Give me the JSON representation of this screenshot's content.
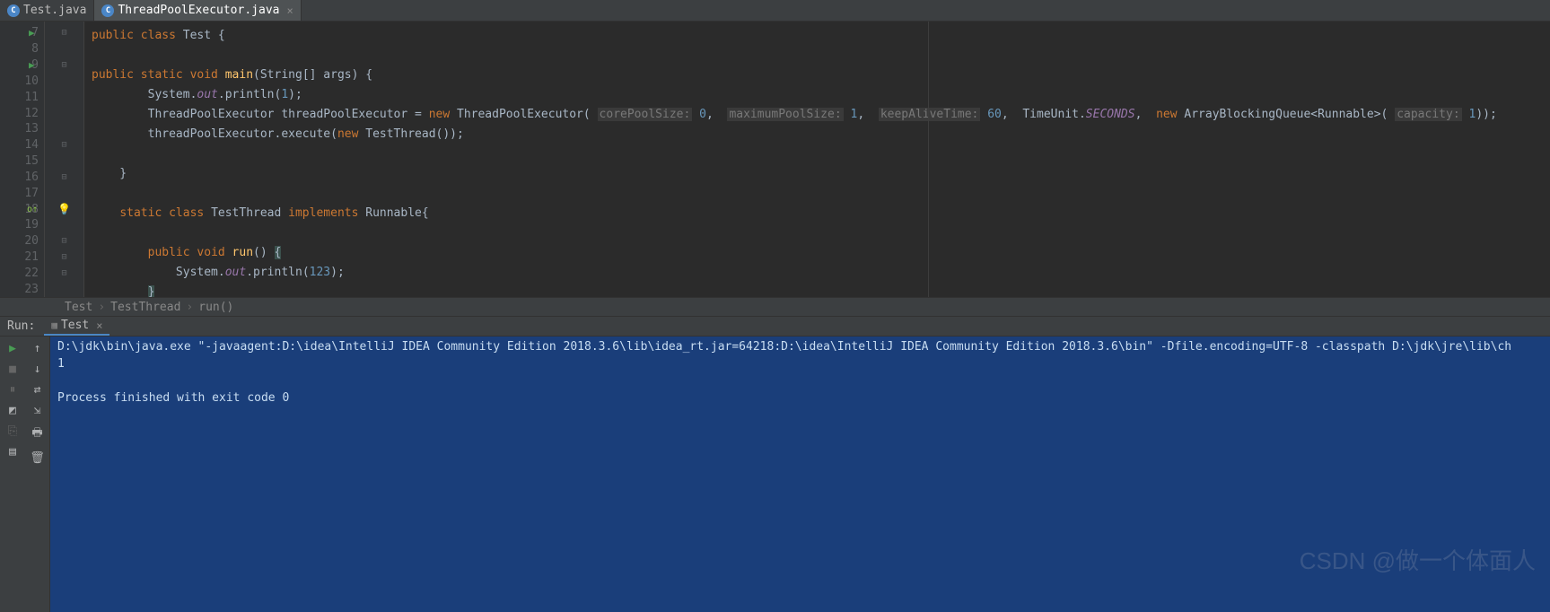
{
  "tabs": [
    {
      "label": "Test.java",
      "active": false
    },
    {
      "label": "ThreadPoolExecutor.java",
      "active": true
    }
  ],
  "line_numbers": [
    "7",
    "8",
    "9",
    "10",
    "11",
    "12",
    "13",
    "14",
    "15",
    "16",
    "17",
    "18",
    "19",
    "20",
    "21",
    "22",
    "23"
  ],
  "code": {
    "l7": {
      "pre": "public class ",
      "cls": "Test",
      "post": " {"
    },
    "l9": {
      "pre": "    ",
      "kw1": "public static void ",
      "fn": "main",
      "post": "(String[] args) {"
    },
    "l10": {
      "pre": "        System.",
      "field": "out",
      "mid": ".println(",
      "num": "1",
      "post": ");"
    },
    "l11": {
      "pre": "        ThreadPoolExecutor threadPoolExecutor = ",
      "kw": "new",
      "mid1": " ThreadPoolExecutor( ",
      "hint1": "corePoolSize:",
      "n1": " 0",
      "c1": ",  ",
      "hint2": "maximumPoolSize:",
      "n2": " 1",
      "c2": ",  ",
      "hint3": "keepAliveTime:",
      "n3": " 60",
      "c3": ",  TimeUnit.",
      "field2": "SECONDS",
      "c4": ",  ",
      "kw2": "new",
      "mid2": " ArrayBlockingQueue<Runnable>( ",
      "hint4": "capacity:",
      "n4": " 1",
      "post": "));"
    },
    "l12": {
      "pre": "        threadPoolExecutor.execute(",
      "kw": "new",
      "mid": " TestThread())",
      "post": ";"
    },
    "l14": {
      "txt": "    }"
    },
    "l16": {
      "pre": "    ",
      "kw1": "static class ",
      "cls": "TestThread ",
      "kw2": "implements ",
      "iface": "Runnable",
      "post": "{"
    },
    "l18": {
      "pre": "        ",
      "kw": "public void ",
      "fn": "run",
      "post": "() ",
      "brace": "{"
    },
    "l19": {
      "pre": "            System.",
      "field": "out",
      "mid": ".println(",
      "num": "123",
      "post": ");"
    },
    "l20": {
      "pre": "        ",
      "brace": "}"
    },
    "l21": {
      "txt": "    }"
    },
    "l22": {
      "txt": "}"
    }
  },
  "breadcrumb": {
    "c1": "Test",
    "c2": "TestThread",
    "c3": "run()"
  },
  "run": {
    "label": "Run:",
    "tab": "Test",
    "console": [
      "D:\\jdk\\bin\\java.exe \"-javaagent:D:\\idea\\IntelliJ IDEA Community Edition 2018.3.6\\lib\\idea_rt.jar=64218:D:\\idea\\IntelliJ IDEA Community Edition 2018.3.6\\bin\" -Dfile.encoding=UTF-8 -classpath D:\\jdk\\jre\\lib\\ch",
      "1",
      "",
      "Process finished with exit code 0"
    ]
  },
  "watermark": "CSDN @做一个体面人"
}
